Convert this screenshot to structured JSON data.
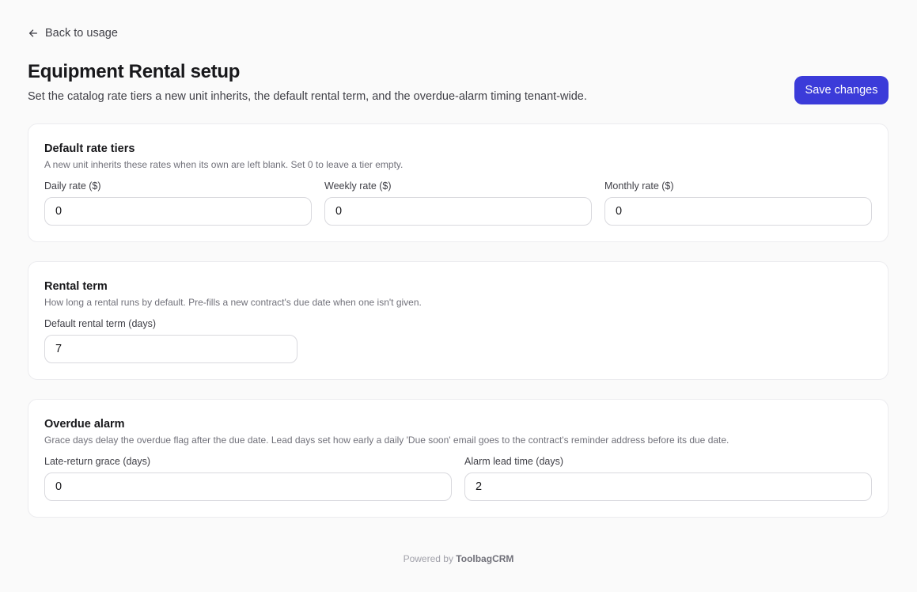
{
  "nav": {
    "back_label": "Back to usage"
  },
  "header": {
    "title": "Equipment Rental setup",
    "subtitle": "Set the catalog rate tiers a new unit inherits, the default rental term, and the overdue-alarm timing tenant-wide.",
    "save_label": "Save changes"
  },
  "rates": {
    "title": "Default rate tiers",
    "description": "A new unit inherits these rates when its own are left blank. Set 0 to leave a tier empty.",
    "daily": {
      "label": "Daily rate ($)",
      "value": "0"
    },
    "weekly": {
      "label": "Weekly rate ($)",
      "value": "0"
    },
    "monthly": {
      "label": "Monthly rate ($)",
      "value": "0"
    }
  },
  "term": {
    "title": "Rental term",
    "description": "How long a rental runs by default. Pre-fills a new contract's due date when one isn't given.",
    "default_term": {
      "label": "Default rental term (days)",
      "value": "7"
    }
  },
  "alarm": {
    "title": "Overdue alarm",
    "description": "Grace days delay the overdue flag after the due date. Lead days set how early a daily 'Due soon' email goes to the contract's reminder address before its due date.",
    "grace": {
      "label": "Late-return grace (days)",
      "value": "0"
    },
    "lead": {
      "label": "Alarm lead time (days)",
      "value": "2"
    }
  },
  "footer": {
    "prefix": "Powered by",
    "brand": "ToolbagCRM"
  },
  "colors": {
    "accent": "#3b3bd9",
    "background": "#fafafa"
  }
}
